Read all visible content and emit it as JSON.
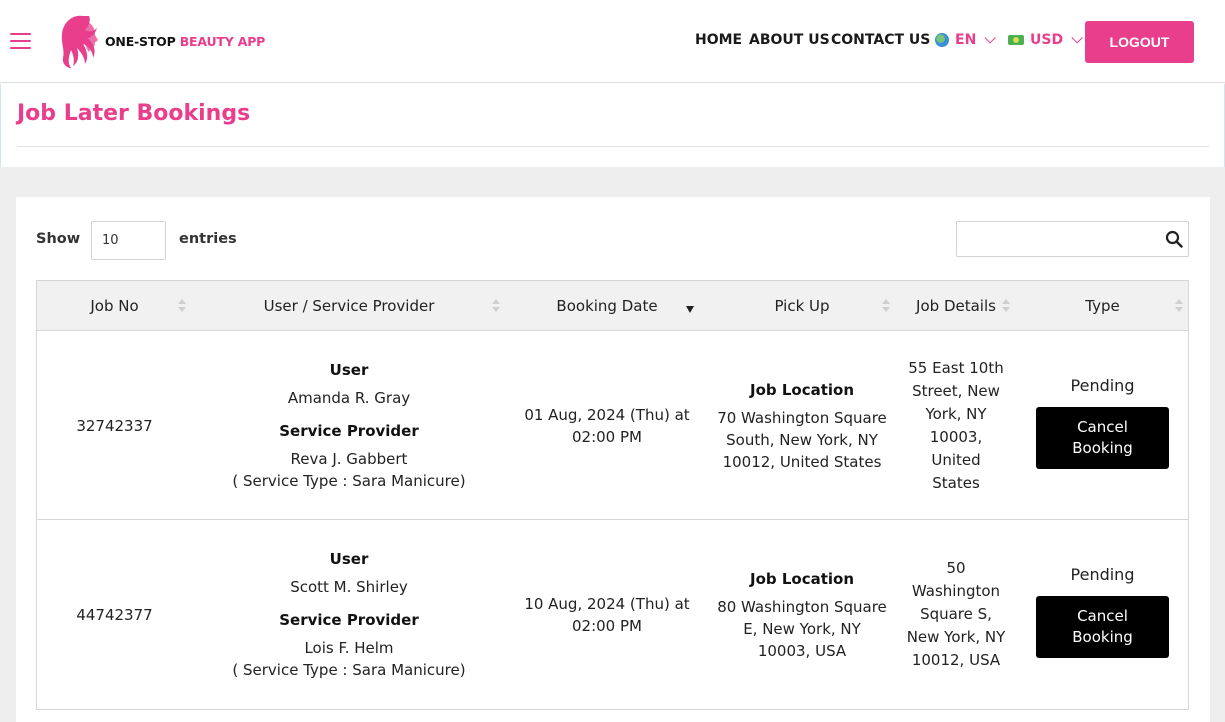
{
  "brand": {
    "part1": "ONE-STOP",
    "part2": "BEAUTY APP"
  },
  "nav": {
    "home": "HOME",
    "about": "ABOUT US",
    "contact": "CONTACT US"
  },
  "language": {
    "selected": "EN"
  },
  "currency": {
    "selected": "USD"
  },
  "logout_label": "LOGOUT",
  "page_title": "Job Later Bookings",
  "table_controls": {
    "show_label": "Show",
    "entries_value": "10",
    "entries_label": "entries",
    "search_value": ""
  },
  "table": {
    "headers": [
      "Job No",
      "User / Service Provider",
      "Booking Date",
      "Pick Up",
      "Job Details",
      "Type"
    ],
    "labels": {
      "user": "User",
      "service_provider": "Service Provider",
      "job_location": "Job Location",
      "cancel": "Cancel Booking"
    },
    "rows": [
      {
        "job_no": "32742337",
        "user": "Amanda R. Gray",
        "provider": "Reva J. Gabbert",
        "service_type": "( Service Type : Sara Manicure)",
        "booking_date": "01 Aug, 2024 (Thu) at",
        "booking_time": "02:00 PM",
        "pickup": "70 Washington Square South, New York, NY 10012, United States",
        "job_details": "55 East 10th Street, New York, NY 10003, United States",
        "type": "Pending"
      },
      {
        "job_no": "44742377",
        "user": "Scott M. Shirley",
        "provider": "Lois F. Helm",
        "service_type": "( Service Type : Sara Manicure)",
        "booking_date": "10 Aug, 2024 (Thu) at",
        "booking_time": "02:00 PM",
        "pickup": "80 Washington Square E, New York, NY 10003, USA",
        "job_details": "50 Washington Square S, New York, NY 10012, USA",
        "type": "Pending"
      }
    ]
  },
  "colors": {
    "accent": "#e83e8c",
    "button_dark": "#000000",
    "background_grey": "#eeeeee"
  }
}
